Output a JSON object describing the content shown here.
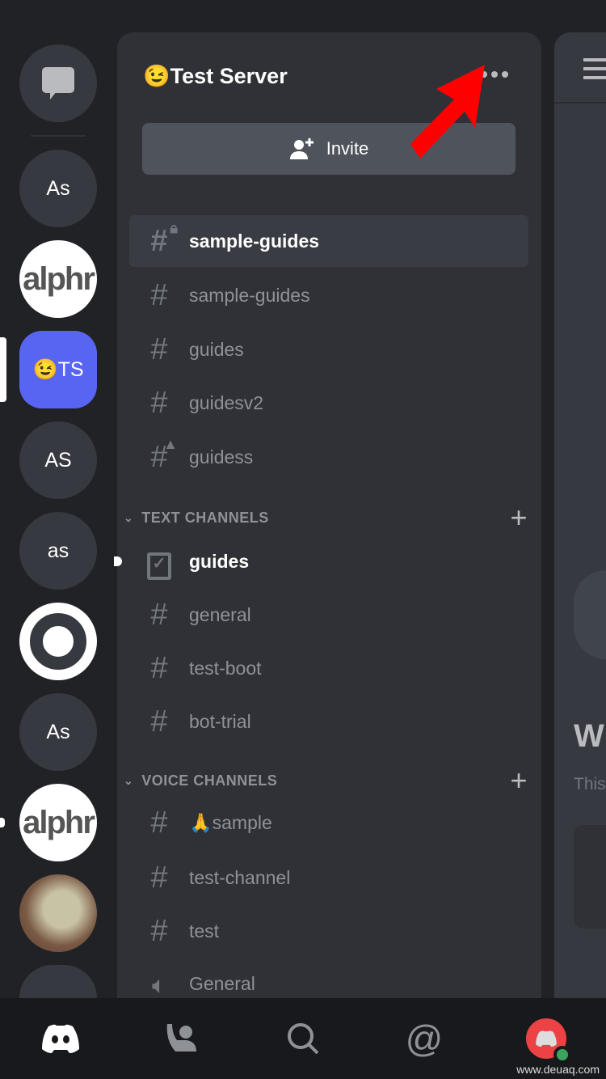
{
  "rail": {
    "servers": [
      {
        "type": "dm",
        "icon": "chat-bubble-icon"
      },
      {
        "label": "As"
      },
      {
        "label": "alphr",
        "logo": true
      },
      {
        "label": "TS",
        "emoji": "😉",
        "active": true
      },
      {
        "label": "AS"
      },
      {
        "label": "as"
      },
      {
        "label": "",
        "icon": "ring-icon"
      },
      {
        "label": "As"
      },
      {
        "label": "alphr",
        "logo": true
      },
      {
        "label": "",
        "icon": "dog-photo"
      },
      {
        "label": ""
      }
    ]
  },
  "server": {
    "emoji": "😉",
    "name": "Test Server",
    "more_icon": "more-dots-icon",
    "invite_label": "Invite"
  },
  "channels": [
    {
      "name": "sample-guides",
      "icon": "hash-lock",
      "selected": true
    },
    {
      "name": "sample-guides",
      "icon": "hash"
    },
    {
      "name": "guides",
      "icon": "hash"
    },
    {
      "name": "guidesv2",
      "icon": "hash"
    },
    {
      "name": "guidess",
      "icon": "hash-warning"
    }
  ],
  "text_category": {
    "label": "TEXT CHANNELS",
    "channels": [
      {
        "name": "guides",
        "icon": "rules",
        "unread": true
      },
      {
        "name": "general",
        "icon": "hash"
      },
      {
        "name": "test-boot",
        "icon": "hash"
      },
      {
        "name": "bot-trial",
        "icon": "hash"
      }
    ]
  },
  "voice_category": {
    "label": "VOICE CHANNELS",
    "channels": [
      {
        "name": "🙏sample",
        "icon": "hash"
      },
      {
        "name": "test-channel",
        "icon": "hash"
      },
      {
        "name": "test",
        "icon": "hash"
      },
      {
        "name": "General",
        "icon": "speaker"
      }
    ]
  },
  "right": {
    "heading": "W",
    "sub": "This"
  },
  "nav": [
    "home",
    "friends",
    "search",
    "mentions",
    "profile"
  ],
  "colors": {
    "accent": "#5865f2",
    "arrow": "#ff0000",
    "status": "#3ba55d",
    "avatar": "#ed4245"
  },
  "watermark": "www.deuaq.com"
}
